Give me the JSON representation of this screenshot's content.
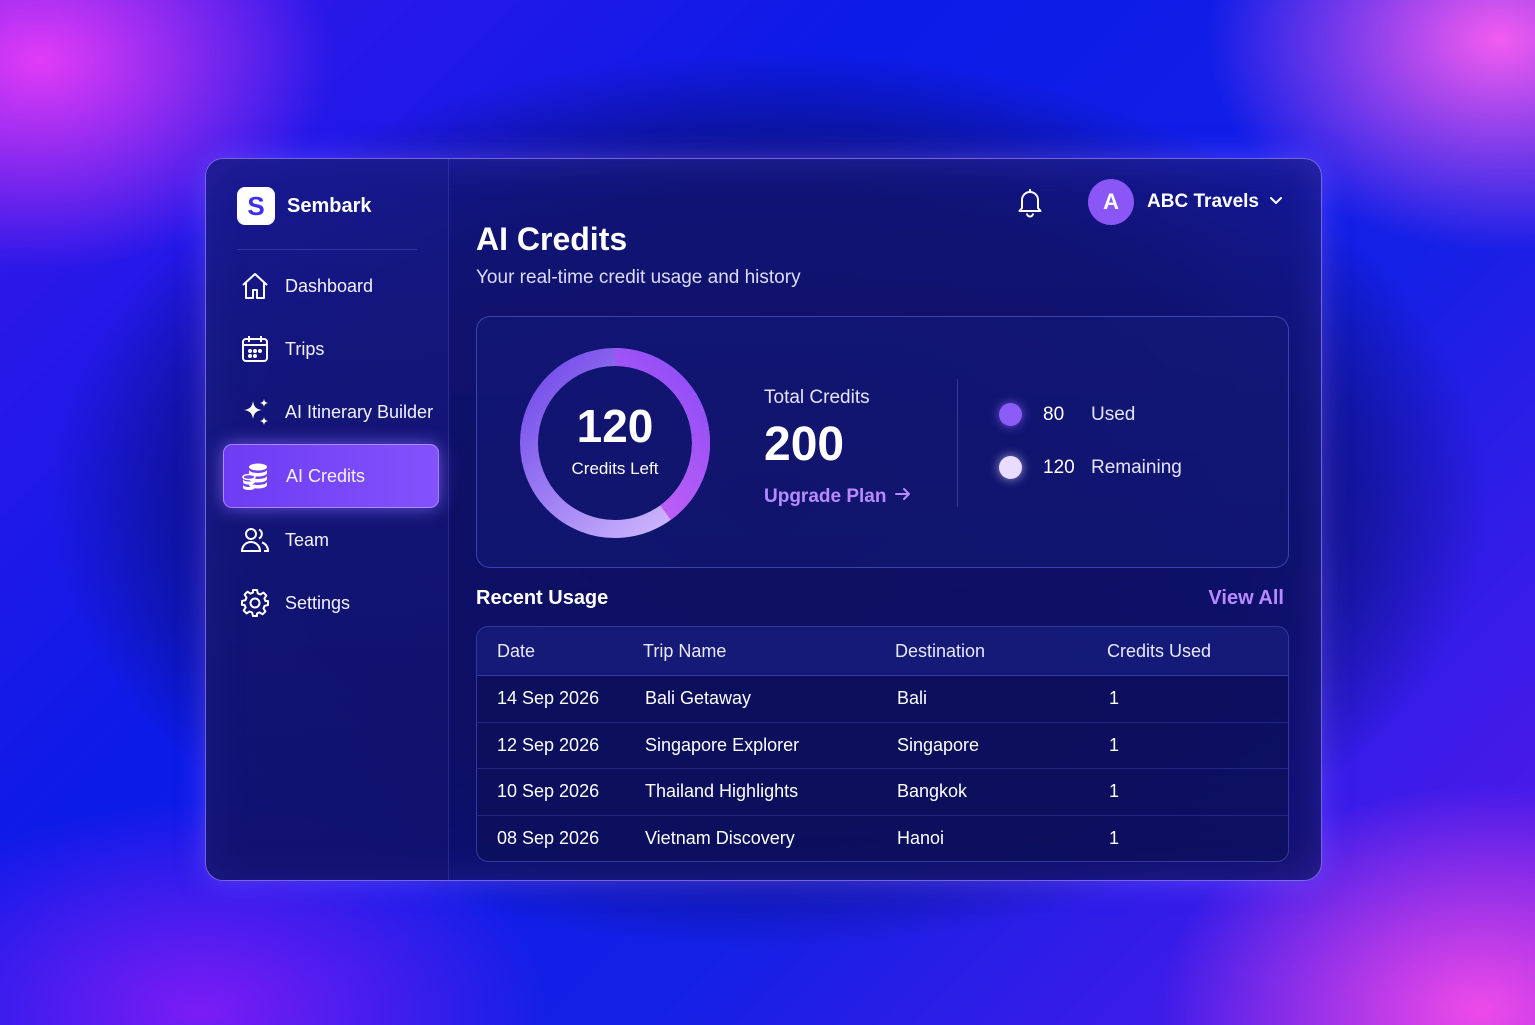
{
  "brand": {
    "logo_letter": "S",
    "name": "Sembark"
  },
  "sidebar": {
    "items": [
      {
        "label": "Dashboard",
        "icon": "home-icon",
        "active": false
      },
      {
        "label": "Trips",
        "icon": "calendar-icon",
        "active": false
      },
      {
        "label": "AI Itinerary Builder",
        "icon": "sparkles-icon",
        "active": false
      },
      {
        "label": "AI Credits",
        "icon": "coins-icon",
        "active": true
      },
      {
        "label": "Team",
        "icon": "users-icon",
        "active": false
      },
      {
        "label": "Settings",
        "icon": "gear-icon",
        "active": false
      }
    ]
  },
  "topbar": {
    "bell_icon": "bell-icon",
    "avatar_letter": "A",
    "account_name": "ABC Travels",
    "dropdown_icon": "chevron-down-icon"
  },
  "header": {
    "title": "AI Credits",
    "subtitle": "Your real-time credit usage and history"
  },
  "credits": {
    "remaining": "120",
    "remaining_label": "Credits Left",
    "total_label": "Total Credits",
    "total": "200",
    "upgrade_label": "Upgrade Plan",
    "used_value": "80",
    "used_label": "Used",
    "remaining_value": "120",
    "remaining_name": "Remaining",
    "used_fraction": 0.4,
    "colors": {
      "used": "#8b5cf6",
      "remaining": "#e9dcff",
      "accent": "#b78bff"
    }
  },
  "usage": {
    "title": "Recent Usage",
    "view_all": "View All",
    "columns": [
      "Date",
      "Trip Name",
      "Destination",
      "Credits Used"
    ],
    "rows": [
      [
        "14 Sep 2026",
        "Bali Getaway",
        "Bali",
        "1"
      ],
      [
        "12 Sep 2026",
        "Singapore Explorer",
        "Singapore",
        "1"
      ],
      [
        "10 Sep 2026",
        "Thailand Highlights",
        "Bangkok",
        "1"
      ],
      [
        "08 Sep 2026",
        "Vietnam Discovery",
        "Hanoi",
        "1"
      ]
    ]
  }
}
